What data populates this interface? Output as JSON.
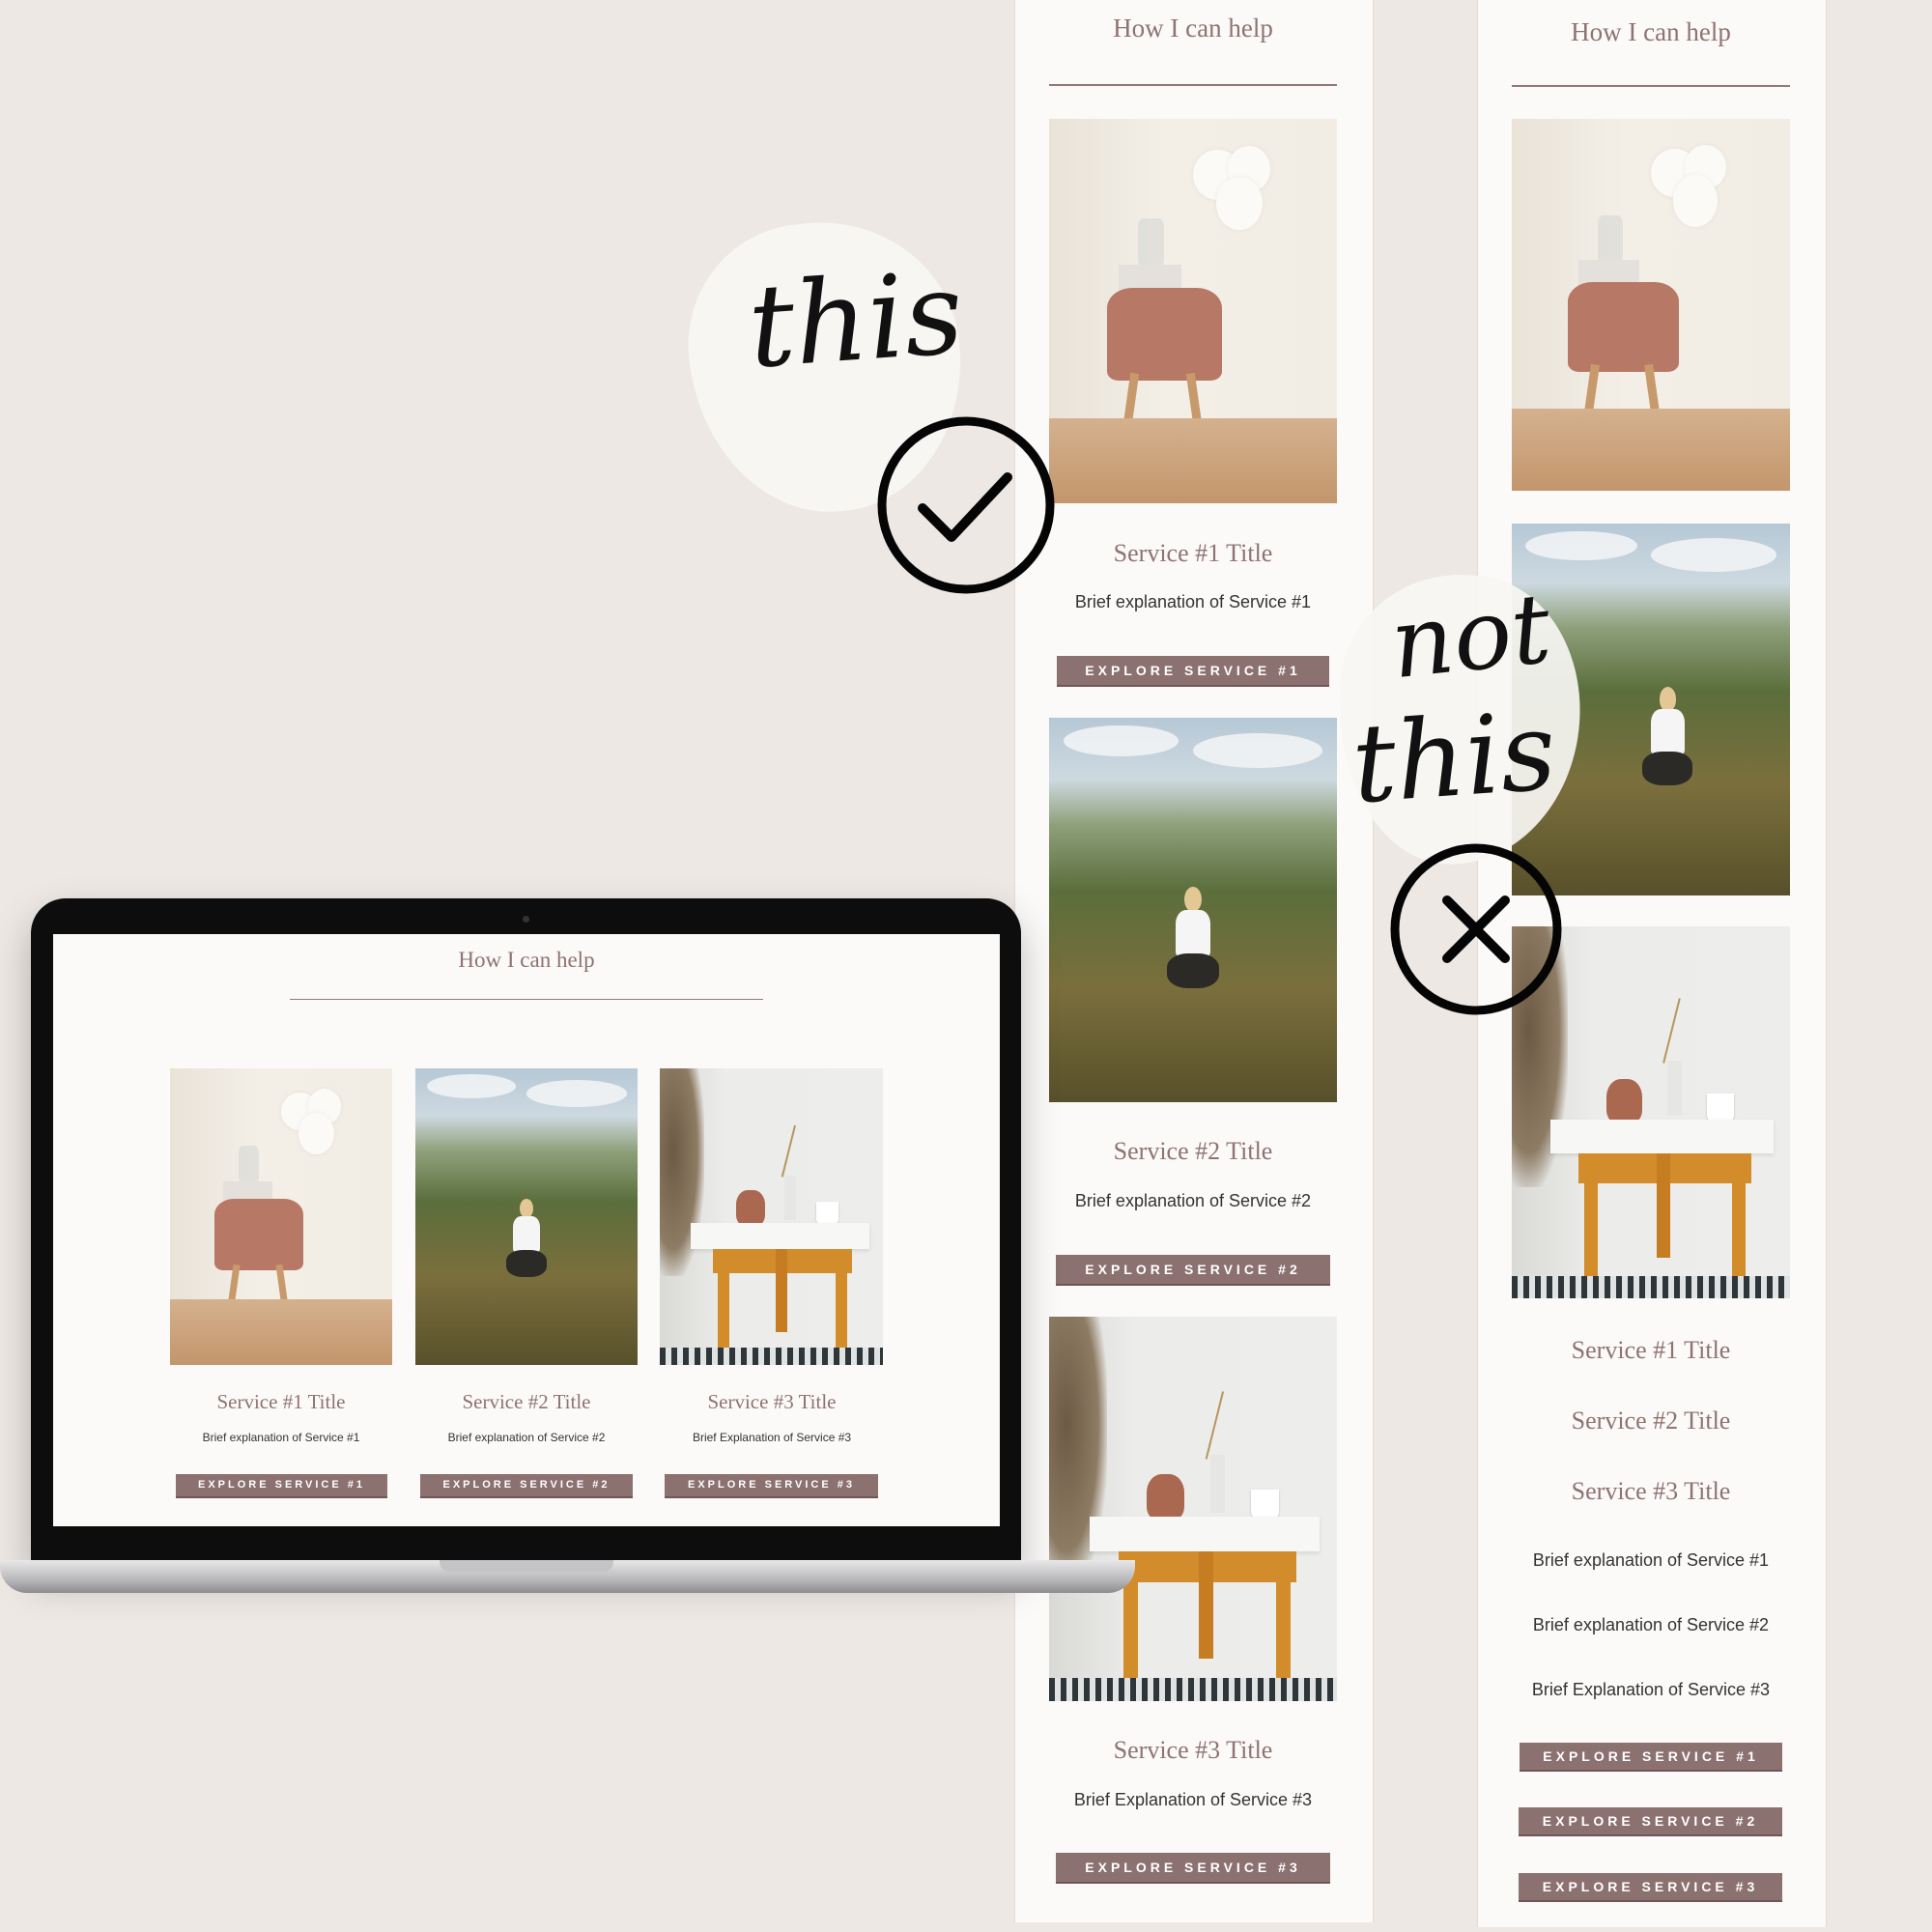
{
  "section_heading": "How I can help",
  "services": [
    {
      "title": "Service #1 Title",
      "desc": "Brief explanation of Service #1",
      "button": "EXPLORE SERVICE #1"
    },
    {
      "title": "Service #2 Title",
      "desc": "Brief explanation of Service #2",
      "button": "EXPLORE SERVICE #2"
    },
    {
      "title": "Service #3 Title",
      "desc": "Brief Explanation of Service #3",
      "button": "EXPLORE SERVICE #3"
    }
  ],
  "annotations": {
    "good": "this",
    "bad_line1": "not",
    "bad_line2": "this"
  },
  "icons": {
    "good": "checkmark-circle-icon",
    "bad": "x-circle-icon"
  },
  "colors": {
    "background": "#ede8e4",
    "accent": "#8c7171",
    "title": "#8e7372"
  }
}
